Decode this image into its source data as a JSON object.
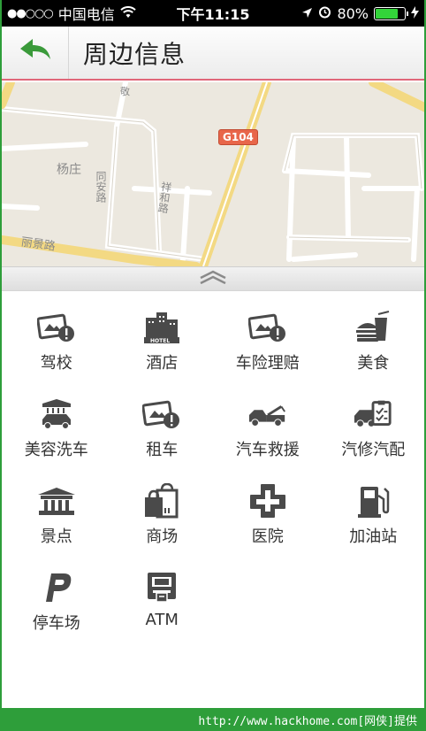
{
  "status_bar": {
    "carrier": "中国电信",
    "time": "下午11:15",
    "battery_percent": "80%",
    "battery_level": 0.8
  },
  "header": {
    "title": "周边信息"
  },
  "map": {
    "road_badge": "G104",
    "labels": [
      "杨庄",
      "同安路",
      "丽景路",
      "祥和路",
      "敬"
    ]
  },
  "categories": [
    {
      "label": "驾校",
      "icon": "driving-school-icon"
    },
    {
      "label": "酒店",
      "icon": "hotel-icon"
    },
    {
      "label": "车险理赔",
      "icon": "insurance-claim-icon"
    },
    {
      "label": "美食",
      "icon": "food-icon"
    },
    {
      "label": "美容洗车",
      "icon": "car-wash-icon"
    },
    {
      "label": "租车",
      "icon": "car-rental-icon"
    },
    {
      "label": "汽车救援",
      "icon": "tow-truck-icon"
    },
    {
      "label": "汽修汽配",
      "icon": "car-repair-icon"
    },
    {
      "label": "景点",
      "icon": "attraction-icon"
    },
    {
      "label": "商场",
      "icon": "shopping-mall-icon"
    },
    {
      "label": "医院",
      "icon": "hospital-icon"
    },
    {
      "label": "加油站",
      "icon": "gas-station-icon"
    },
    {
      "label": "停车场",
      "icon": "parking-icon"
    },
    {
      "label": "ATM",
      "icon": "atm-icon"
    }
  ],
  "footer": {
    "text": "http://www.hackhome.com[网侠]提供"
  },
  "colors": {
    "accent_green": "#2e9e3a",
    "back_arrow": "#3a9a3a",
    "header_underline": "#e0677a",
    "icon_gray": "#4a4a4a"
  }
}
